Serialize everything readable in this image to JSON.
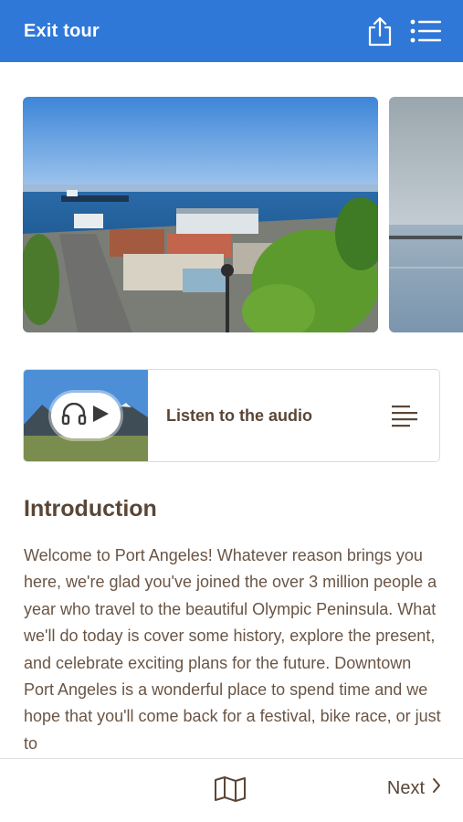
{
  "header": {
    "exit_label": "Exit tour",
    "share_icon": "share-icon",
    "menu_icon": "list-menu-icon",
    "background_color": "#2f78d8"
  },
  "carousel": {
    "slides": [
      {
        "description": "Port Angeles waterfront harbor view"
      },
      {
        "description": "Calm water and shoreline"
      }
    ]
  },
  "audio": {
    "label": "Listen to the audio",
    "play_icon": "play-icon",
    "headphones_icon": "headphones-icon",
    "transcript_icon": "transcript-lines-icon"
  },
  "intro": {
    "title": "Introduction",
    "body": "Welcome to Port Angeles! Whatever reason brings you here, we're glad you've joined the over 3 million people a year who travel to the beautiful Olympic Peninsula. What we'll do today is cover some history, explore the present, and celebrate exciting plans for the future. Downtown Port Angeles is a wonderful place to spend time and we hope that you'll come back for a festival, bike race, or just to"
  },
  "footer": {
    "map_icon": "map-icon",
    "next_label": "Next",
    "next_icon": "chevron-right-icon"
  },
  "colors": {
    "text": "#5b4636",
    "accent": "#2f78d8"
  }
}
